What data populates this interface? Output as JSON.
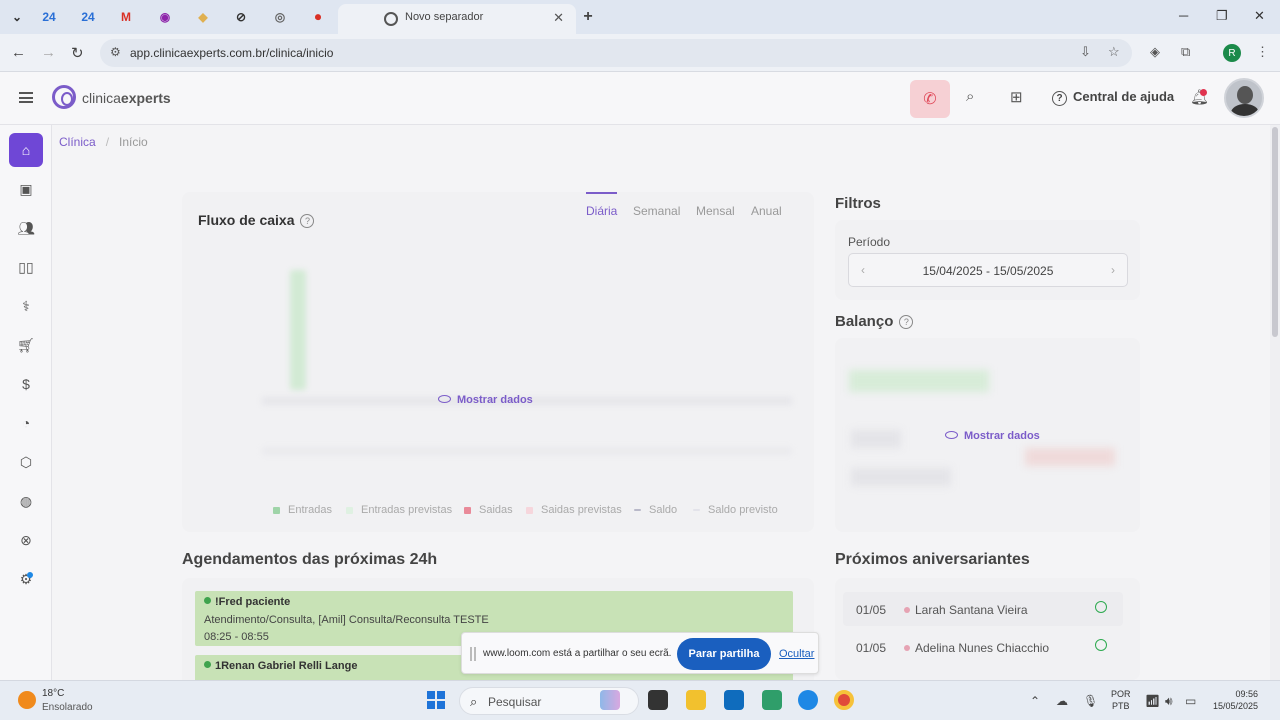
{
  "browser": {
    "tab_active_title": "Novo separador",
    "tab_badges": [
      "24",
      "24"
    ],
    "url": "app.clinicaexperts.com.br/clinica/inicio",
    "profile_initial": "R"
  },
  "header": {
    "logo_light": "clinica",
    "logo_bold": "experts",
    "help_label": "Central de ajuda"
  },
  "breadcrumb": {
    "root": "Clínica",
    "current": "Início"
  },
  "cashflow": {
    "title": "Fluxo de caixa",
    "tabs": [
      "Diária",
      "Semanal",
      "Mensal",
      "Anual"
    ],
    "active_tab": "Diária",
    "show_data": "Mostrar dados",
    "legend": [
      {
        "label": "Entradas",
        "color": "#9fd4a8"
      },
      {
        "label": "Entradas previstas",
        "color": "#dff1e2"
      },
      {
        "label": "Saidas",
        "color": "#e98a99"
      },
      {
        "label": "Saidas previstas",
        "color": "#f6d6dc"
      },
      {
        "label": "Saldo",
        "color": "#b9b9c9"
      },
      {
        "label": "Saldo previsto",
        "color": "#e3e3ea"
      }
    ]
  },
  "filters": {
    "title": "Filtros",
    "period_label": "Período",
    "date_range": "15/04/2025 - 15/05/2025"
  },
  "balance": {
    "title": "Balanço",
    "show_data": "Mostrar dados"
  },
  "appointments": {
    "title": "Agendamentos das próximas 24h",
    "items": [
      {
        "name": "!Fred paciente",
        "desc": "Atendimento/Consulta, [Amil] Consulta/Reconsulta TESTE",
        "time": "08:25 - 08:55"
      },
      {
        "name": "1Renan Gabriel Relli Lange",
        "desc": "",
        "time": ""
      }
    ]
  },
  "birthdays": {
    "title": "Próximos aniversariantes",
    "items": [
      {
        "date": "01/05",
        "name": "Larah Santana Vieira"
      },
      {
        "date": "01/05",
        "name": "Adelina Nunes Chiacchio"
      }
    ]
  },
  "loom": {
    "message": "www.loom.com está a partilhar o seu ecrã.",
    "stop_label": "Parar partilha",
    "hide_label": "Ocultar"
  },
  "taskbar": {
    "temperature": "18°C",
    "weather": "Ensolarado",
    "search_placeholder": "Pesquisar",
    "lang_top": "POR",
    "lang_bottom": "PTB",
    "time": "09:56",
    "date": "15/05/2025"
  },
  "colors": {
    "accent": "#6f47d6",
    "whatsapp": "#2eaa50",
    "appointment_bg": "#c8e2b6",
    "loom_button": "#1a5fbf"
  }
}
